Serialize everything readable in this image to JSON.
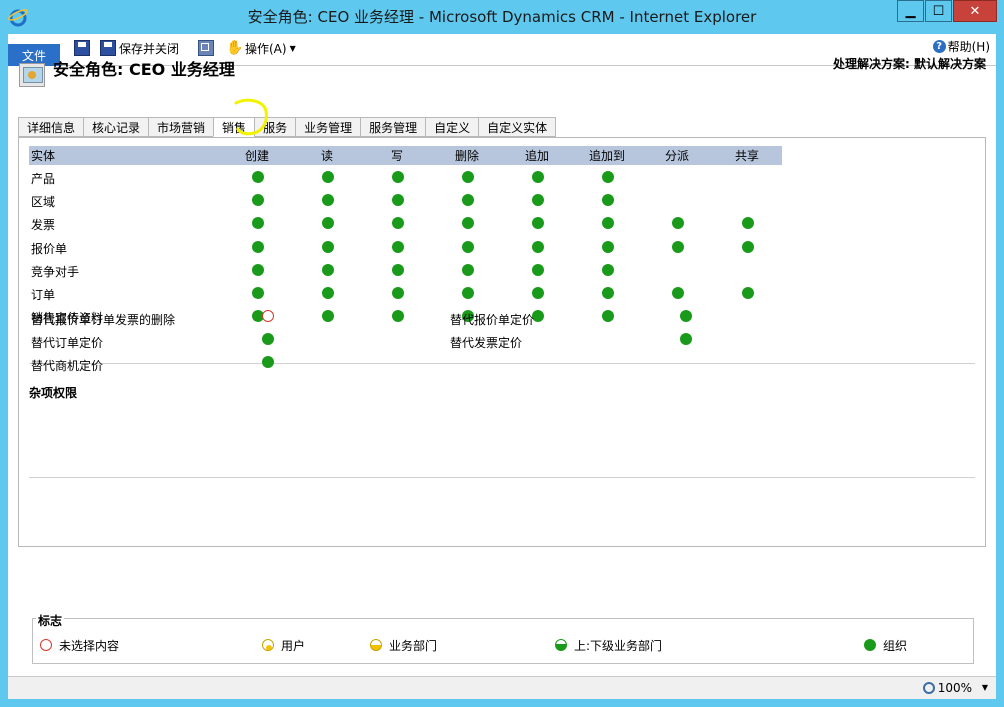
{
  "window": {
    "title": "安全角色: CEO 业务经理 - Microsoft Dynamics CRM - Internet Explorer",
    "min": "▁",
    "max": "☐",
    "close": "✕"
  },
  "ribbon": {
    "file": "文件",
    "save_label": "",
    "save_close_label": "保存并关闭",
    "copy_label": "",
    "actions_label": "操作(A)",
    "help_label": "帮助(H)"
  },
  "header": {
    "title": "安全角色: CEO 业务经理",
    "solution": "处理解决方案: 默认解决方案"
  },
  "tabs": [
    "详细信息",
    "核心记录",
    "市场营销",
    "销售",
    "服务",
    "业务管理",
    "服务管理",
    "自定义",
    "自定义实体"
  ],
  "active_tab": "销售",
  "grid": {
    "columns": [
      "实体",
      "创建",
      "读",
      "写",
      "删除",
      "追加",
      "追加到",
      "分派",
      "共享"
    ],
    "rows": [
      {
        "entity": "产品",
        "privileges": [
          "org",
          "org",
          "org",
          "org",
          "org",
          "org",
          null,
          null
        ]
      },
      {
        "entity": "区域",
        "privileges": [
          "org",
          "org",
          "org",
          "org",
          "org",
          "org",
          null,
          null
        ]
      },
      {
        "entity": "发票",
        "privileges": [
          "org",
          "org",
          "org",
          "org",
          "org",
          "org",
          "org",
          "org"
        ]
      },
      {
        "entity": "报价单",
        "privileges": [
          "org",
          "org",
          "org",
          "org",
          "org",
          "org",
          "org",
          "org"
        ]
      },
      {
        "entity": "竞争对手",
        "privileges": [
          "org",
          "org",
          "org",
          "org",
          "org",
          "org",
          null,
          null
        ]
      },
      {
        "entity": "订单",
        "privileges": [
          "org",
          "org",
          "org",
          "org",
          "org",
          "org",
          "org",
          "org"
        ]
      },
      {
        "entity": "销售宣传资料",
        "privileges": [
          "org",
          "org",
          "org",
          "org",
          "org",
          "org",
          null,
          null
        ]
      }
    ]
  },
  "misc": {
    "title": "杂项权限",
    "items": [
      {
        "label": "替代报价单订单发票的删除",
        "value": "none"
      },
      {
        "label": "替代订单定价",
        "value": "org"
      },
      {
        "label": "替代商机定价",
        "value": "org"
      },
      {
        "label": "替代报价单定价",
        "value": "org"
      },
      {
        "label": "替代发票定价",
        "value": "org"
      }
    ]
  },
  "legend": {
    "title": "标志",
    "items": [
      "未选择内容",
      "用户",
      "业务部门",
      "上:下级业务部门",
      "组织"
    ]
  },
  "status": {
    "zoom": "100%"
  },
  "colors": {
    "titlebar": "#5ec8ef",
    "privilege_dot": "#1a9a1a",
    "grid_header": "#b7c6dc",
    "file_tab": "#2b70c8"
  }
}
